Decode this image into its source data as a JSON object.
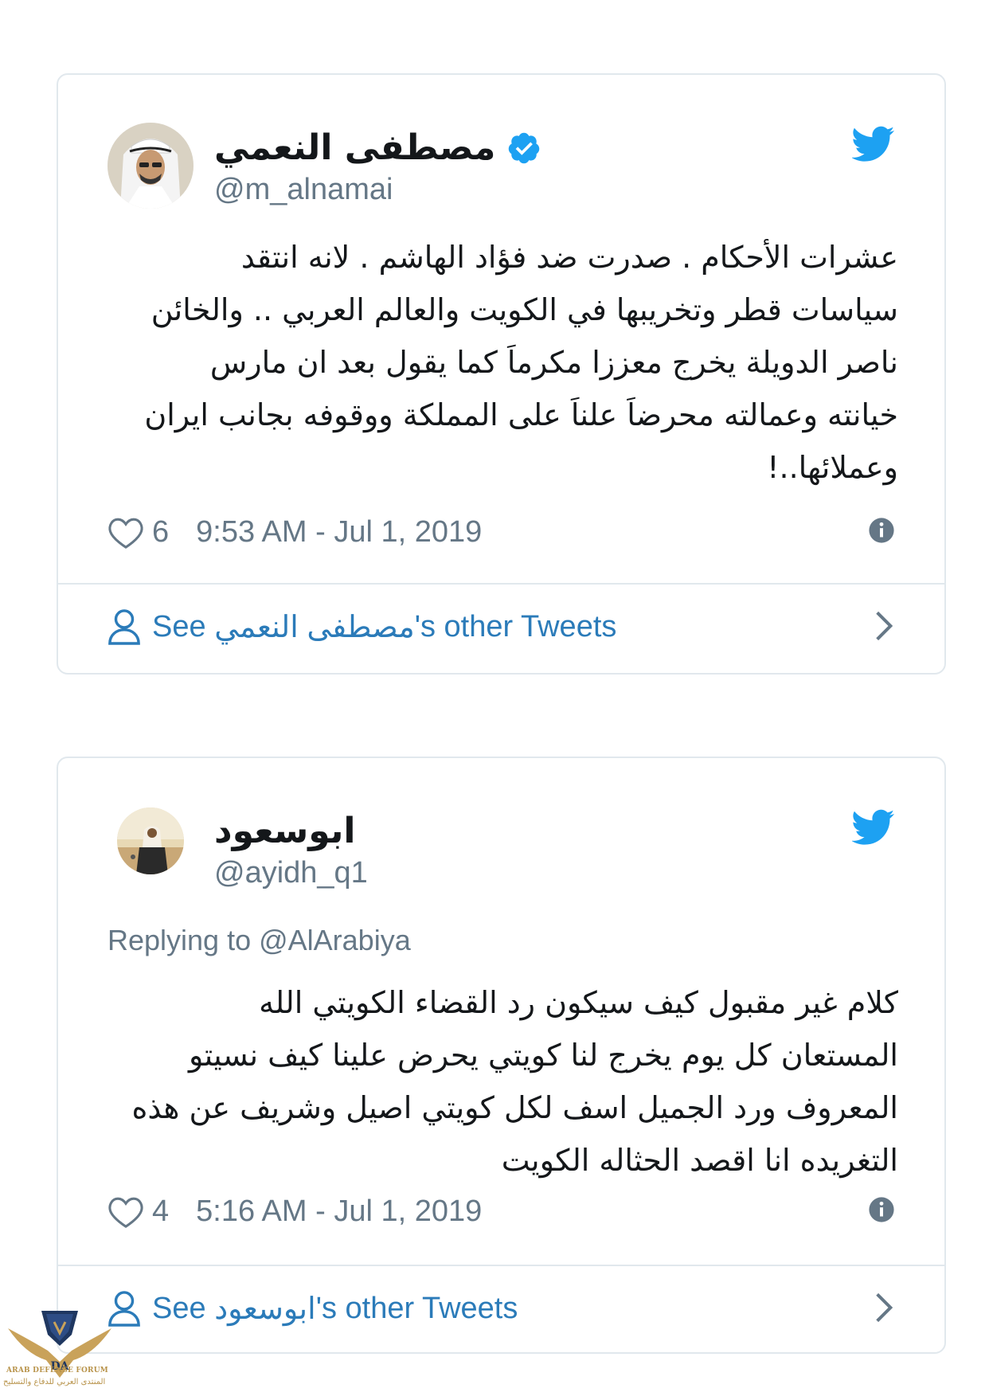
{
  "tweets": [
    {
      "display_name": "مصطفى النعمي",
      "verified": true,
      "handle": "@m_alnamai",
      "reply_to": "",
      "text": "عشرات الأحكام . صدرت ضد فؤاد الهاشم . لانه انتقد\nسياسات قطر وتخريبها في الكويت والعالم العربي .. والخائن\nناصر الدويلة يخرج معززا مكرماَ كما يقول  بعد ان مارس\nخيانته وعمالته  محرضاَ علناَ  على المملكة ووقوفه بجانب ايران\nوعملائها..!",
      "likes": "6",
      "timestamp": "9:53 AM - Jul 1, 2019",
      "see_prefix": "See ",
      "see_name": "مصطفى النعمي",
      "see_suffix": "'s other Tweets"
    },
    {
      "display_name": "ابوسعود",
      "verified": false,
      "handle": "@ayidh_q1",
      "reply_to": "Replying to @AlArabiya",
      "text": "كلام غير مقبول كيف سيكون رد القضاء الكويتي الله\nالمستعان كل يوم يخرج لنا كويتي يحرض علينا كيف نسيتو\nالمعروف ورد الجميل اسف لكل كويتي اصيل وشريف عن هذه\nالتغريده انا اقصد الحثاله الكويت",
      "likes": "4",
      "timestamp": "5:16 AM - Jul 1, 2019",
      "see_prefix": "See ",
      "see_name": "ابوسعود",
      "see_suffix": "'s other Tweets"
    }
  ],
  "watermark": {
    "line1": "ARAB DEFENSE FORUM",
    "line2": "المنتدى العربي للدفاع والتسليح"
  },
  "colors": {
    "twitter_blue": "#1da1f2",
    "link_blue": "#2b7bb9",
    "secondary_text": "#657786",
    "border": "#e1e8ed"
  },
  "icons": [
    "twitter-bird-icon",
    "verified-badge-icon",
    "heart-icon",
    "info-icon",
    "person-icon",
    "chevron-right-icon"
  ]
}
